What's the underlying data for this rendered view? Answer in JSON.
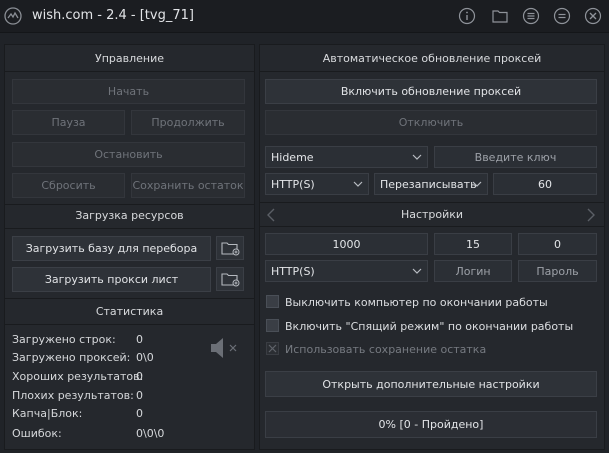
{
  "window": {
    "title": "wish.com  - 2.4 - [tvg_71]",
    "icons": [
      "app-logo-icon",
      "info-icon",
      "folder-icon",
      "list-icon",
      "menu-icon",
      "close-icon"
    ]
  },
  "left": {
    "management": {
      "title": "Управление",
      "start": "Начать",
      "pause": "Пауза",
      "continue": "Продолжить",
      "stop": "Остановить",
      "reset": "Сбросить",
      "save_rest": "Сохранить остаток"
    },
    "resources": {
      "title": "Загрузка ресурсов",
      "load_base": "Загрузить базу для перебора",
      "load_proxy": "Загрузить прокси лист"
    },
    "stats": {
      "title": "Статистика",
      "rows": [
        {
          "label": "Загружено строк:",
          "value": "0"
        },
        {
          "label": "Загружено проксей:",
          "value": "0\\0"
        },
        {
          "label": "Хороших результатов:",
          "value": "0"
        },
        {
          "label": "Плохих результатов:",
          "value": "0"
        },
        {
          "label": "Капча|Блок:",
          "value": "0"
        },
        {
          "label": "Ошибок:",
          "value": "0\\0\\0"
        }
      ],
      "sound_icon": "speaker-muted-icon"
    }
  },
  "right": {
    "proxy_update": {
      "title": "Автоматическое обновление проксей",
      "enable": "Включить обновление проксей",
      "disable": "Отключить",
      "provider": "Hideme",
      "key_placeholder": "Введите ключ",
      "protocol": "HTTP(S)",
      "mode": "Перезаписывать",
      "interval": "60"
    },
    "settings": {
      "title": "Настройки",
      "threads": "1000",
      "timeout": "15",
      "retries": "0",
      "protocol": "HTTP(S)",
      "login_placeholder": "Логин",
      "password_placeholder": "Пароль",
      "opt_shutdown": "Выключить компьютер по окончании работы",
      "opt_sleep": "Включить \"Спящий режим\" по окончании работы",
      "opt_save_rest": "Использовать сохранение остатка",
      "advanced": "Открыть дополнительные настройки"
    },
    "progress": {
      "text": "0% [0 - Пройдено]",
      "percent": 0
    }
  },
  "colors": {
    "background": "#202328",
    "panel": "#25282d",
    "button": "#2e3238",
    "text": "#e1e3e6",
    "disabled_text": "#6f737a"
  }
}
